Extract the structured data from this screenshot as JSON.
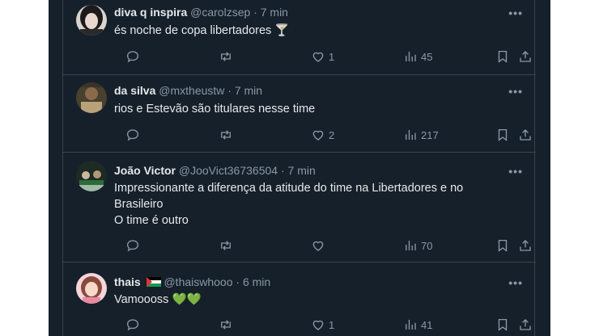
{
  "tweets": [
    {
      "name": "diva q inspira",
      "handle": "@carolzsep",
      "time": "7 min",
      "lines": [
        "és noche de copa libertadores 🍸"
      ],
      "replies": "",
      "retweets": "",
      "likes": "1",
      "views": "45"
    },
    {
      "name": "da silva",
      "handle": "@mxtheustw",
      "time": "7 min",
      "lines": [
        "rios e Estevão são titulares nesse time"
      ],
      "replies": "",
      "retweets": "",
      "likes": "2",
      "views": "217"
    },
    {
      "name": "João Victor",
      "handle": "@JooVict36736504",
      "time": "7 min",
      "lines": [
        "Impressionante a diferença da atitude do time na Libertadores e no",
        "Brasileiro",
        "O time é outro"
      ],
      "replies": "",
      "retweets": "",
      "likes": "",
      "views": "70"
    },
    {
      "name": "thais",
      "handle": "@thaiswhooo",
      "time": "6 min",
      "lines": [
        "Vamoooss 💚💚"
      ],
      "replies": "",
      "retweets": "",
      "likes": "1",
      "views": "41"
    }
  ],
  "more_label": "•••",
  "separator": "·",
  "colors": {
    "background": "#15202b",
    "border": "#38444d",
    "text": "#e7e9ea",
    "muted": "#8b98a5",
    "outer": "#ffffff"
  },
  "icons": [
    "reply-icon",
    "retweet-icon",
    "like-icon",
    "views-icon",
    "bookmark-icon",
    "share-icon",
    "more-icon",
    "palestine-flag-icon"
  ]
}
